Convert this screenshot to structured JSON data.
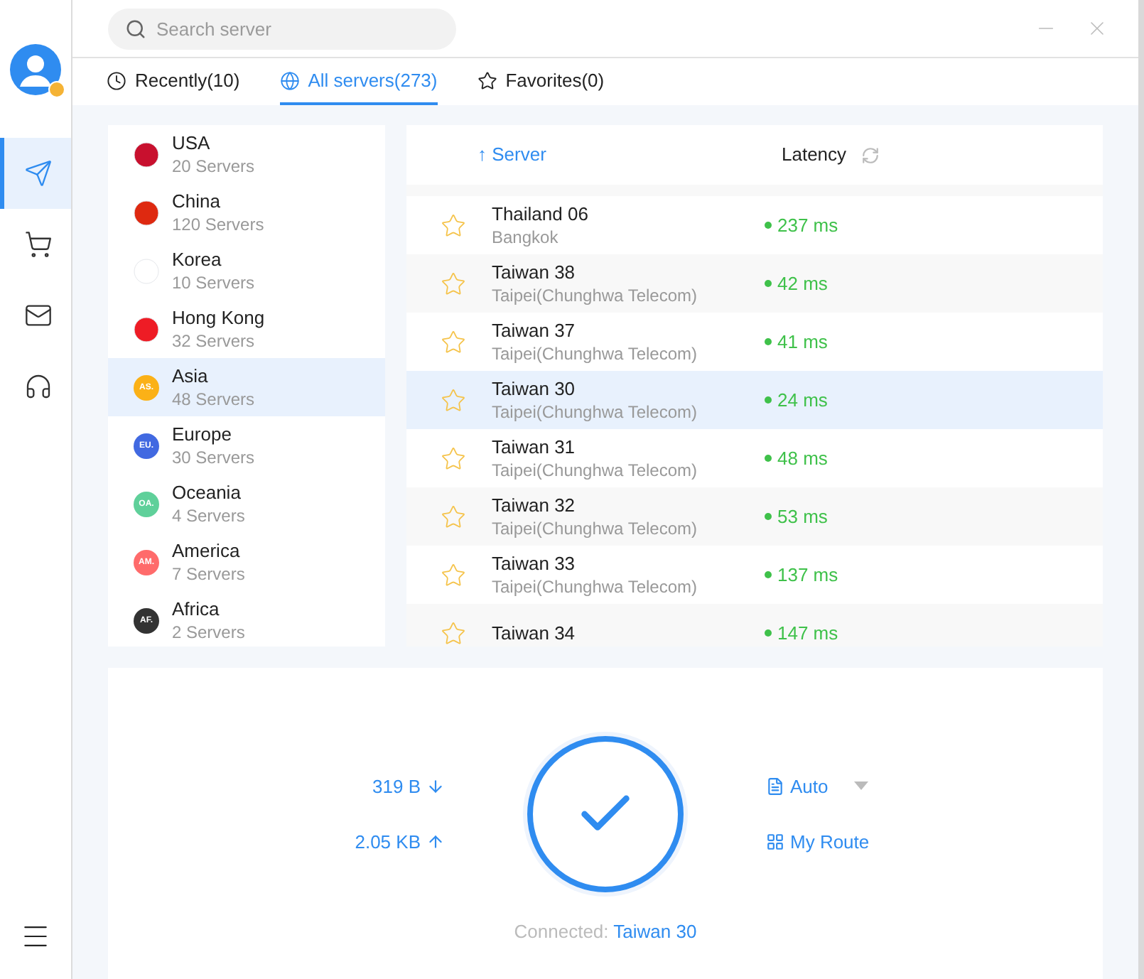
{
  "nav": [
    {
      "kind": "send",
      "selected": true
    },
    {
      "kind": "cart",
      "selected": false
    },
    {
      "kind": "mail",
      "selected": false
    },
    {
      "kind": "support",
      "selected": false
    }
  ],
  "search": {
    "placeholder": "Search server"
  },
  "tabs": [
    {
      "kind": "clock",
      "label": "Recently(10)",
      "selected": false
    },
    {
      "kind": "globe",
      "label": "All servers(273)",
      "selected": true
    },
    {
      "kind": "star",
      "label": "Favorites(0)",
      "selected": false
    }
  ],
  "regions": [
    {
      "name": "USA",
      "count": "20 Servers",
      "kind": "flag",
      "color": "#c8102e",
      "selected": false
    },
    {
      "name": "China",
      "count": "120 Servers",
      "kind": "flag",
      "color": "#de2910",
      "selected": false
    },
    {
      "name": "Korea",
      "count": "10 Servers",
      "kind": "flag",
      "color": "#ffffff",
      "selected": false
    },
    {
      "name": "Hong Kong",
      "count": "32 Servers",
      "kind": "flag",
      "color": "#ee1c25",
      "selected": false
    },
    {
      "name": "Asia",
      "count": "48 Servers",
      "kind": "badge",
      "badge": "AS.",
      "color": "#fbb117",
      "selected": true
    },
    {
      "name": "Europe",
      "count": "30 Servers",
      "kind": "badge",
      "badge": "EU.",
      "color": "#4169e1",
      "selected": false
    },
    {
      "name": "Oceania",
      "count": "4 Servers",
      "kind": "badge",
      "badge": "OA.",
      "color": "#5fd09a",
      "selected": false
    },
    {
      "name": "America",
      "count": "7 Servers",
      "kind": "badge",
      "badge": "AM.",
      "color": "#ff6b6b",
      "selected": false
    },
    {
      "name": "Africa",
      "count": "2 Servers",
      "kind": "badge",
      "badge": "AF.",
      "color": "#333333",
      "selected": false
    }
  ],
  "server_table": {
    "columns": [
      "↑ Server",
      "Latency"
    ],
    "rows": [
      {
        "name": "Thailand 06",
        "location": "Bangkok",
        "latency": "237 ms",
        "favorite": false,
        "selected": false
      },
      {
        "name": "Taiwan 38",
        "location": "Taipei(Chunghwa Telecom)",
        "latency": "42 ms",
        "favorite": false,
        "selected": false
      },
      {
        "name": "Taiwan 37",
        "location": "Taipei(Chunghwa Telecom)",
        "latency": "41 ms",
        "favorite": false,
        "selected": false
      },
      {
        "name": "Taiwan 30",
        "location": "Taipei(Chunghwa Telecom)",
        "latency": "24 ms",
        "favorite": false,
        "selected": true
      },
      {
        "name": "Taiwan 31",
        "location": "Taipei(Chunghwa Telecom)",
        "latency": "48 ms",
        "favorite": false,
        "selected": false
      },
      {
        "name": "Taiwan 32",
        "location": "Taipei(Chunghwa Telecom)",
        "latency": "53 ms",
        "favorite": false,
        "selected": false
      },
      {
        "name": "Taiwan 33",
        "location": "Taipei(Chunghwa Telecom)",
        "latency": "137 ms",
        "favorite": false,
        "selected": false
      },
      {
        "name": "Taiwan 34",
        "latency": "147 ms",
        "favorite": false,
        "selected": false
      }
    ]
  },
  "connection": {
    "download": "319 B",
    "upload": "2.05 KB",
    "connected": true,
    "mode": "Auto",
    "route": "My Route",
    "status_label": "Connected:",
    "server": "Taiwan 30"
  }
}
